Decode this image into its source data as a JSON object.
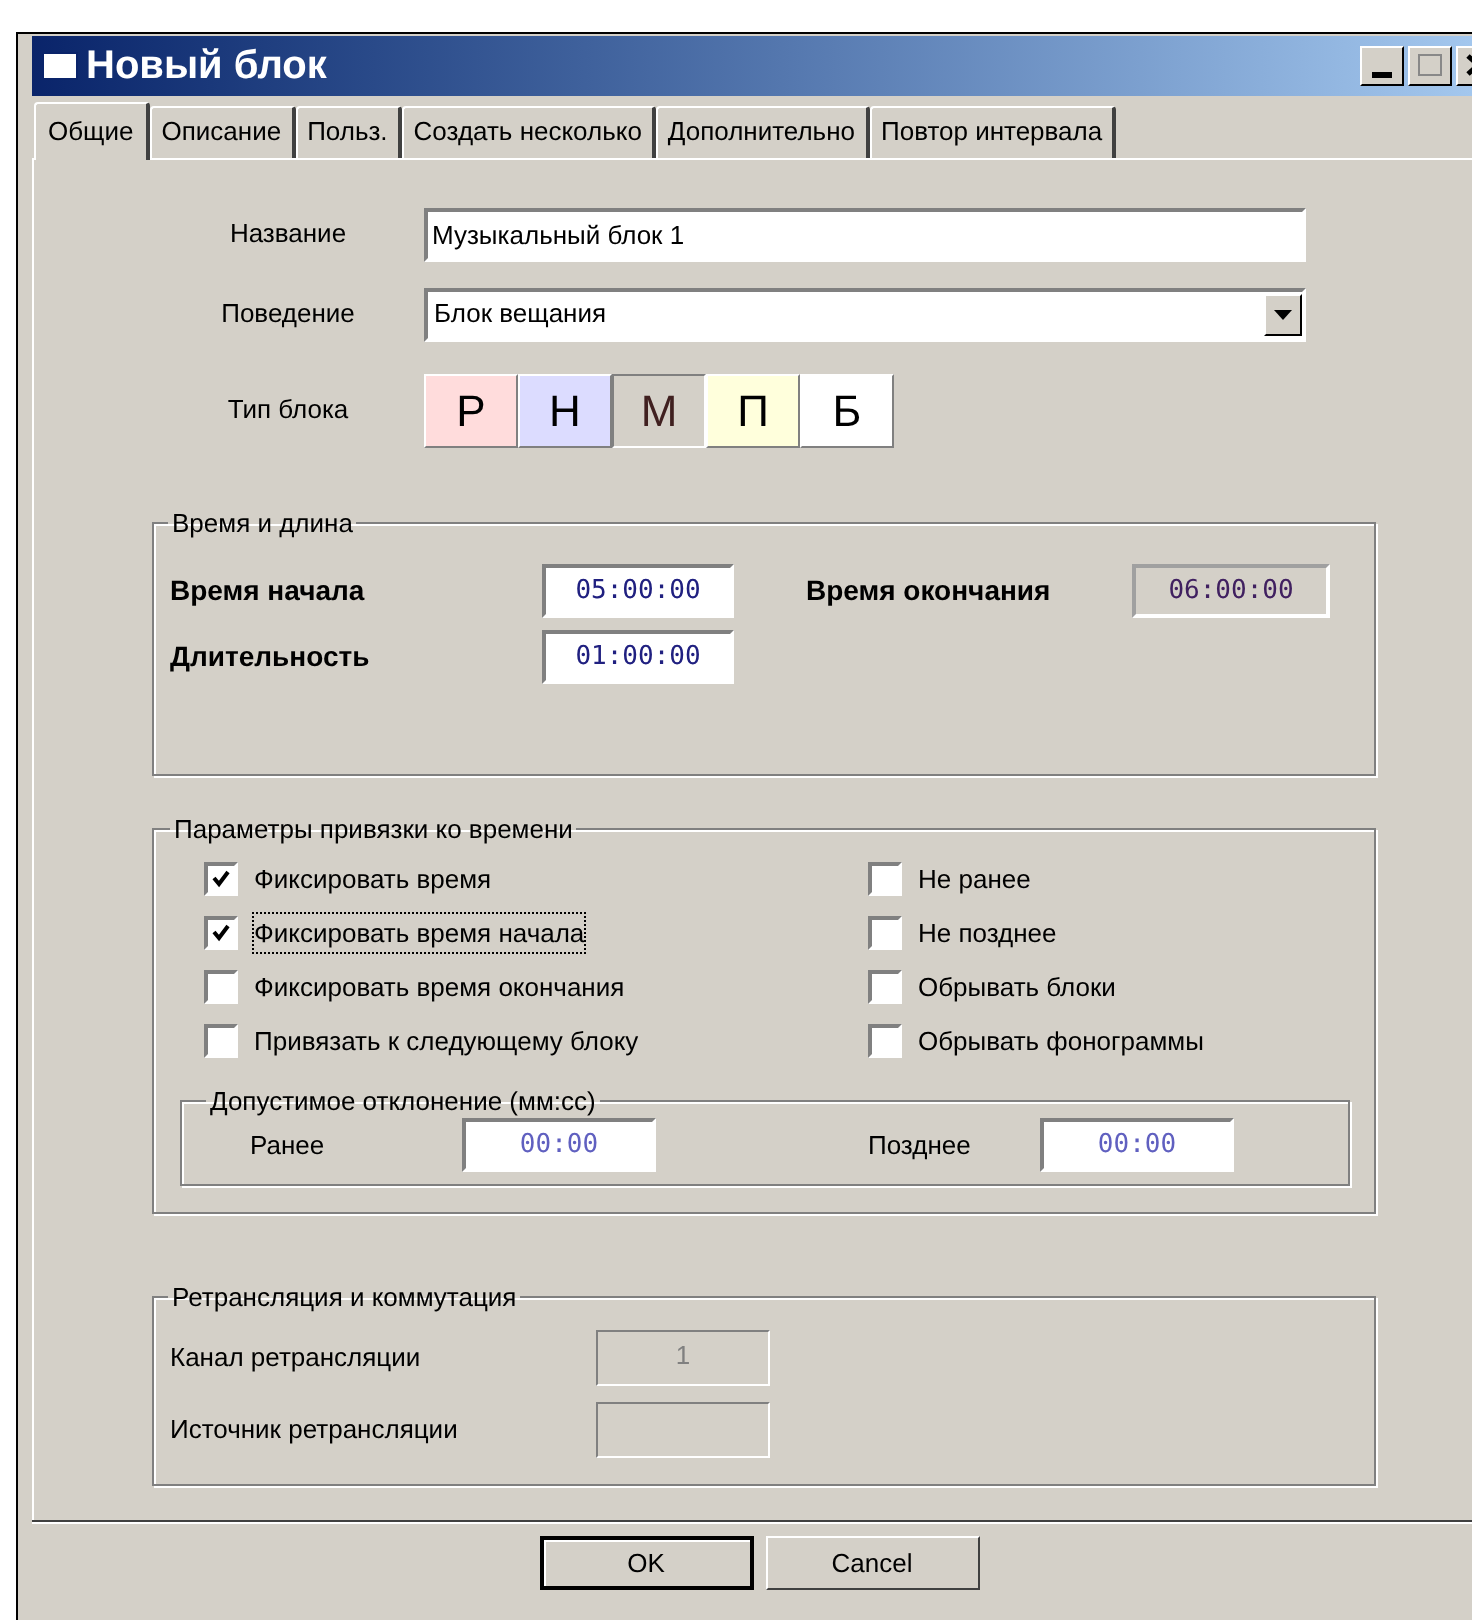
{
  "window": {
    "title": "Новый блок"
  },
  "tabs": [
    {
      "label": "Общие",
      "selected": true
    },
    {
      "label": "Описание",
      "selected": false
    },
    {
      "label": "Польз.",
      "selected": false
    },
    {
      "label": "Создать несколько",
      "selected": false
    },
    {
      "label": "Дополнительно",
      "selected": false
    },
    {
      "label": "Повтор интервала",
      "selected": false
    }
  ],
  "name": {
    "label": "Название",
    "value": "Музыкальный блок 1"
  },
  "behavior": {
    "label": "Поведение",
    "value": "Блок вещания"
  },
  "block_type": {
    "label": "Тип блока",
    "options": [
      {
        "label": "Р",
        "color": "#ffdcdc",
        "selected": false
      },
      {
        "label": "Н",
        "color": "#dcdcff",
        "selected": false
      },
      {
        "label": "М",
        "color": "#d4d0c8",
        "selected": true
      },
      {
        "label": "П",
        "color": "#ffffdc",
        "selected": false
      },
      {
        "label": "Б",
        "color": "#ffffff",
        "selected": false
      }
    ]
  },
  "time_group": {
    "title": "Время и длина",
    "start": {
      "label": "Время начала",
      "value": "05:00:00",
      "disabled": false
    },
    "duration": {
      "label": "Длительность",
      "value": "01:00:00",
      "disabled": false
    },
    "end": {
      "label": "Время окончания",
      "value": "06:00:00",
      "disabled": true
    }
  },
  "anchor_group": {
    "title": "Параметры привязки ко времени",
    "checkboxes_left": [
      {
        "label": "Фиксировать время",
        "checked": true,
        "focused": false
      },
      {
        "label": "Фиксировать время начала",
        "checked": true,
        "focused": true
      },
      {
        "label": "Фиксировать время окончания",
        "checked": false,
        "focused": false
      },
      {
        "label": "Привязать к следующему блоку",
        "checked": false,
        "focused": false
      }
    ],
    "checkboxes_right": [
      {
        "label": "Не ранее",
        "checked": false,
        "focused": false
      },
      {
        "label": "Не позднее",
        "checked": false,
        "focused": false
      },
      {
        "label": "Обрывать блоки",
        "checked": false,
        "focused": false
      },
      {
        "label": "Обрывать фонограммы",
        "checked": false,
        "focused": false
      }
    ],
    "deviation": {
      "title": "Допустимое отклонение (мм:сс)",
      "earlier": {
        "label": "Ранее",
        "value": "00:00"
      },
      "later": {
        "label": "Позднее",
        "value": "00:00"
      }
    }
  },
  "relay_group": {
    "title": "Ретрансляция и коммутация",
    "fields": [
      {
        "label": "Канал ретрансляции",
        "value": "1",
        "disabled": true
      },
      {
        "label": "Источник ретрансляции",
        "disabled": true
      }
    ]
  },
  "buttons": [
    {
      "label": "OK",
      "default": true
    },
    {
      "label": "Cancel",
      "default": false
    }
  ]
}
